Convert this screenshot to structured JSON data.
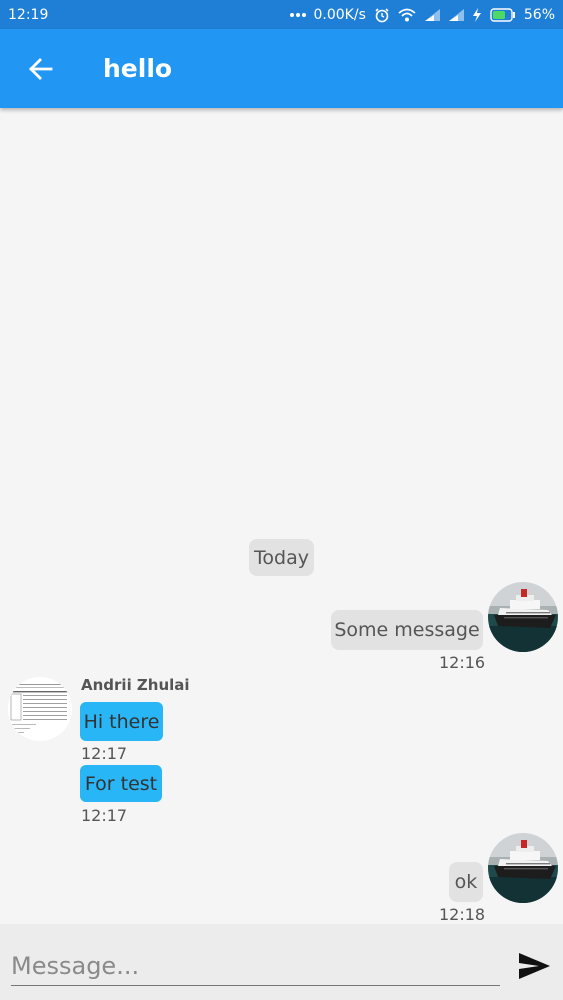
{
  "status_bar": {
    "time": "12:19",
    "net_speed": "0.00K/s",
    "battery": "56%",
    "icons": [
      "more-dots-icon",
      "alarm-icon",
      "wifi-icon",
      "signal-icon",
      "signal-icon",
      "charging-icon",
      "battery-icon"
    ]
  },
  "app_bar": {
    "title": "hello",
    "back_icon": "arrow-back-icon"
  },
  "chat": {
    "date_divider": "Today",
    "messages": [
      {
        "side": "outgoing",
        "text": "Some message",
        "time": "12:16",
        "avatar": "ship-photo"
      },
      {
        "side": "incoming",
        "sender": "Andrii Zhulai",
        "text": "Hi there",
        "time": "12:17",
        "avatar": "document-thumbnail"
      },
      {
        "side": "incoming",
        "text": "For test",
        "time": "12:17"
      },
      {
        "side": "outgoing",
        "text": "ok",
        "time": "12:18",
        "avatar": "ship-photo"
      }
    ]
  },
  "composer": {
    "placeholder": "Message...",
    "value": "",
    "send_icon": "send-icon"
  },
  "colors": {
    "status_bar": "#1f7fd6",
    "app_bar": "#2196f3",
    "incoming_bubble": "#29b6f6",
    "outgoing_bubble": "#e2e2e2",
    "background": "#f5f5f5",
    "battery_fill": "#4cd964"
  }
}
